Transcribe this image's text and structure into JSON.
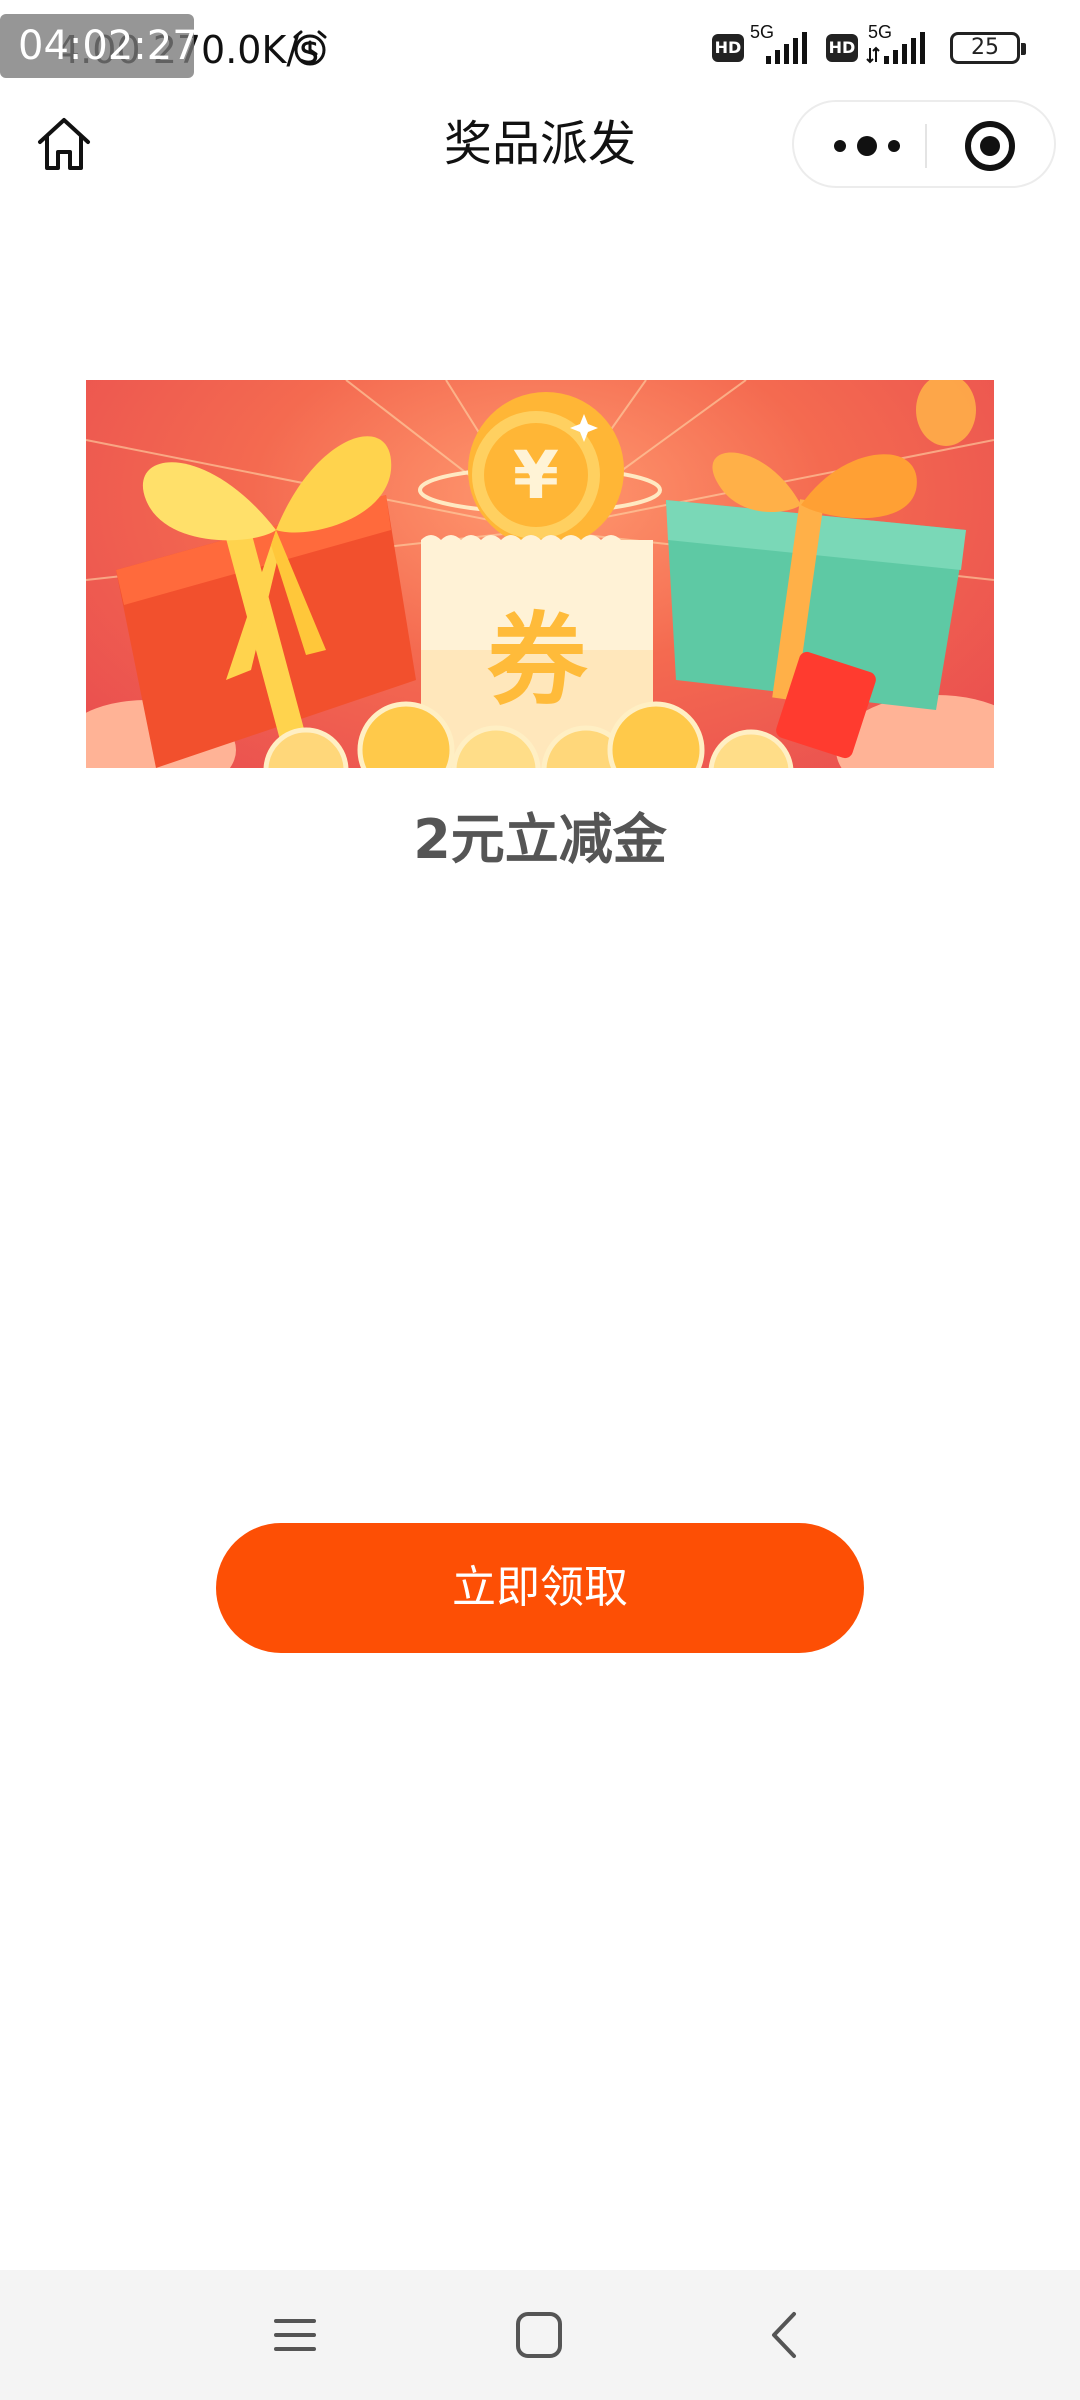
{
  "status_bar": {
    "time": "04:02:27",
    "net_speed": "4.00 270.0K/s",
    "hd_label": "HD",
    "network_1": "5G",
    "network_2": "5G",
    "battery": "25",
    "icons": [
      "alarm-icon",
      "signal-icon",
      "signal-icon",
      "battery-icon"
    ]
  },
  "title_bar": {
    "title": "奖品派发",
    "icons": [
      "home-icon",
      "more-icon",
      "close-miniprogram-icon"
    ]
  },
  "banner": {
    "coupon_char": "券",
    "currency_symbol": "¥"
  },
  "prize": {
    "name": "2元立减金"
  },
  "actions": {
    "claim_label": "立即领取",
    "button_color": "#fd4f05"
  },
  "nav_bar": {
    "icons": [
      "menu-icon",
      "home-square-icon",
      "back-icon"
    ]
  }
}
